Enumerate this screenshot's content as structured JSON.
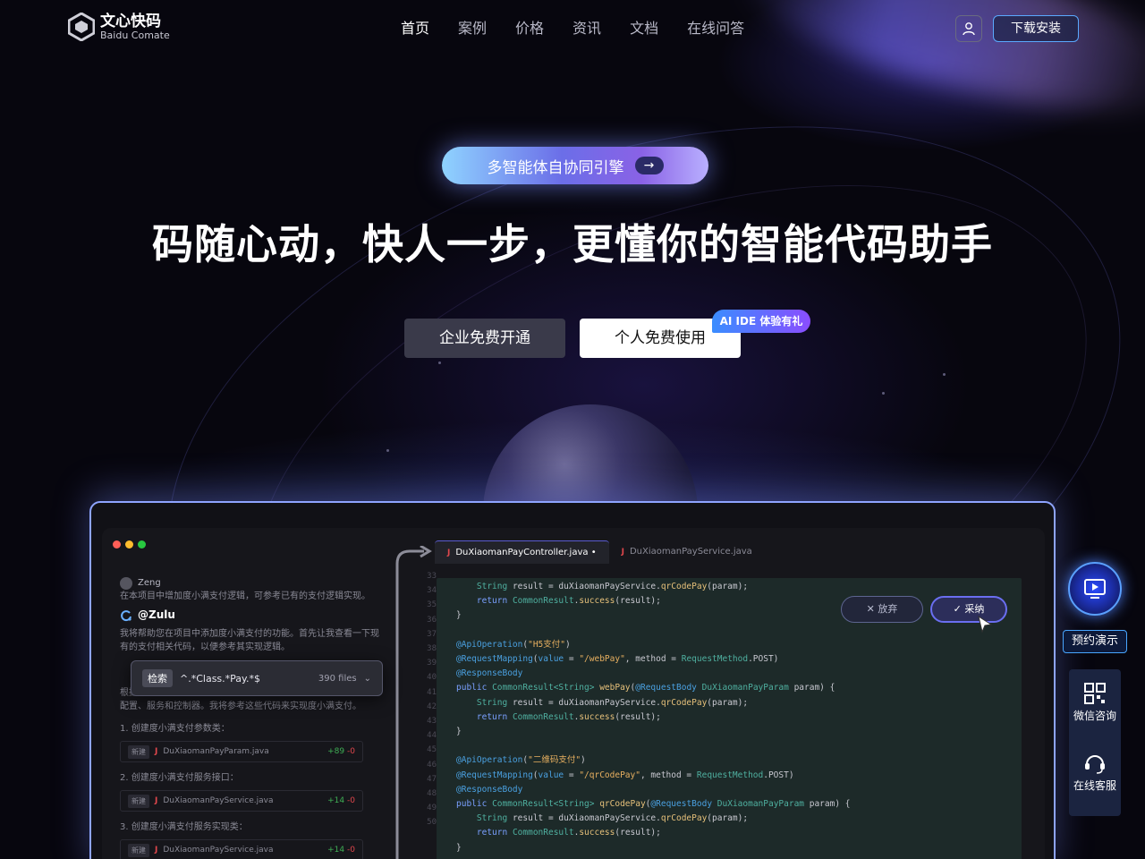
{
  "brand": {
    "name_cn": "文心快码",
    "name_en": "Baidu Comate"
  },
  "nav": {
    "items": [
      {
        "label": "首页",
        "active": true
      },
      {
        "label": "案例"
      },
      {
        "label": "价格"
      },
      {
        "label": "资讯"
      },
      {
        "label": "文档"
      },
      {
        "label": "在线问答"
      }
    ],
    "download": "下载安装"
  },
  "hero": {
    "pill": "多智能体自协同引擎",
    "headline": "码随心动，快人一步，更懂你的智能代码助手",
    "btn_enterprise": "企业免费开通",
    "btn_personal": "个人免费使用",
    "badge": "AI IDE 体验有礼"
  },
  "editor": {
    "chat": {
      "user": "Zeng",
      "request": "在本项目中增加度小满支付逻辑，可参考已有的支付逻辑实现。",
      "agent": "@Zulu",
      "reply1": "我将帮助您在项目中添加度小满支付的功能。首先让我查看一下现有的支付相关代码，以便参考其实现逻辑。",
      "reply2": "根据搜索结果，我发现项目中已经有支付宝支付的完整实现，包括配置、服务和控制器。我将参考这些代码来实现度小满支付。",
      "steps": [
        {
          "title": "1. 创建度小满支付参数类：",
          "tag": "新建",
          "file": "DuXiaomanPayParam.java",
          "add": "+89",
          "del": "-0"
        },
        {
          "title": "2. 创建度小满支付服务接口：",
          "tag": "新建",
          "file": "DuXiaomanPayService.java",
          "add": "+14",
          "del": "-0"
        },
        {
          "title": "3. 创建度小满支付服务实现类：",
          "tag": "新建",
          "file": "DuXiaomanPayService.java",
          "add": "+14",
          "del": "-0"
        }
      ]
    },
    "search": {
      "tag": "检索",
      "query": "^.*Class.*Pay.*$",
      "count": "390 files"
    },
    "tabs": [
      {
        "label": "DuXiaomanPayController.java •",
        "active": true
      },
      {
        "label": "DuXiaomanPayService.java"
      }
    ],
    "line_numbers": [
      "33",
      "34",
      "35",
      "36",
      "37",
      "38",
      "39",
      "40",
      "41",
      "42",
      "43",
      "44",
      "45",
      "46",
      "47",
      "48",
      "49",
      "50"
    ],
    "discard": "✕ 放弃",
    "accept": "✓ 采纳"
  },
  "side": {
    "demo": "预约演示",
    "wechat": "微信咨询",
    "service": "在线客服"
  },
  "colors": {
    "accent": "#5aa9ff",
    "badge_start": "#3a8dff",
    "badge_end": "#8a4dff"
  }
}
